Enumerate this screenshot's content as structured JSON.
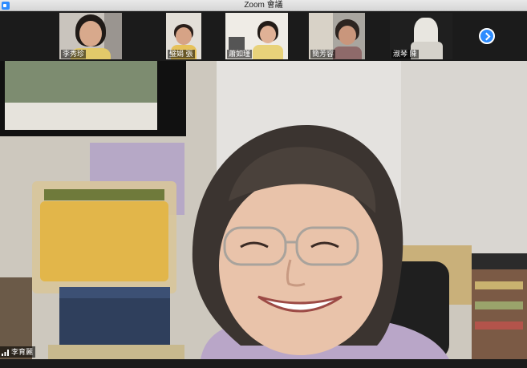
{
  "window": {
    "title": "Zoom 會議",
    "app_icon": "zoom-app-icon"
  },
  "gallery_strip": {
    "participants": [
      {
        "name": "李秀珍"
      },
      {
        "name": "璧娟 張"
      },
      {
        "name": "蕭如瑾"
      },
      {
        "name": "簡芳容"
      },
      {
        "name": "淑琴 陳"
      }
    ],
    "next_button_icon": "chevron-right-icon"
  },
  "main_speaker": {
    "name": "李育麗",
    "signal_icon": "signal-bars-icon"
  },
  "colors": {
    "accent": "#2d8cff",
    "titlebar": "#e0e0e0",
    "strip_background": "#1b1b1b"
  }
}
